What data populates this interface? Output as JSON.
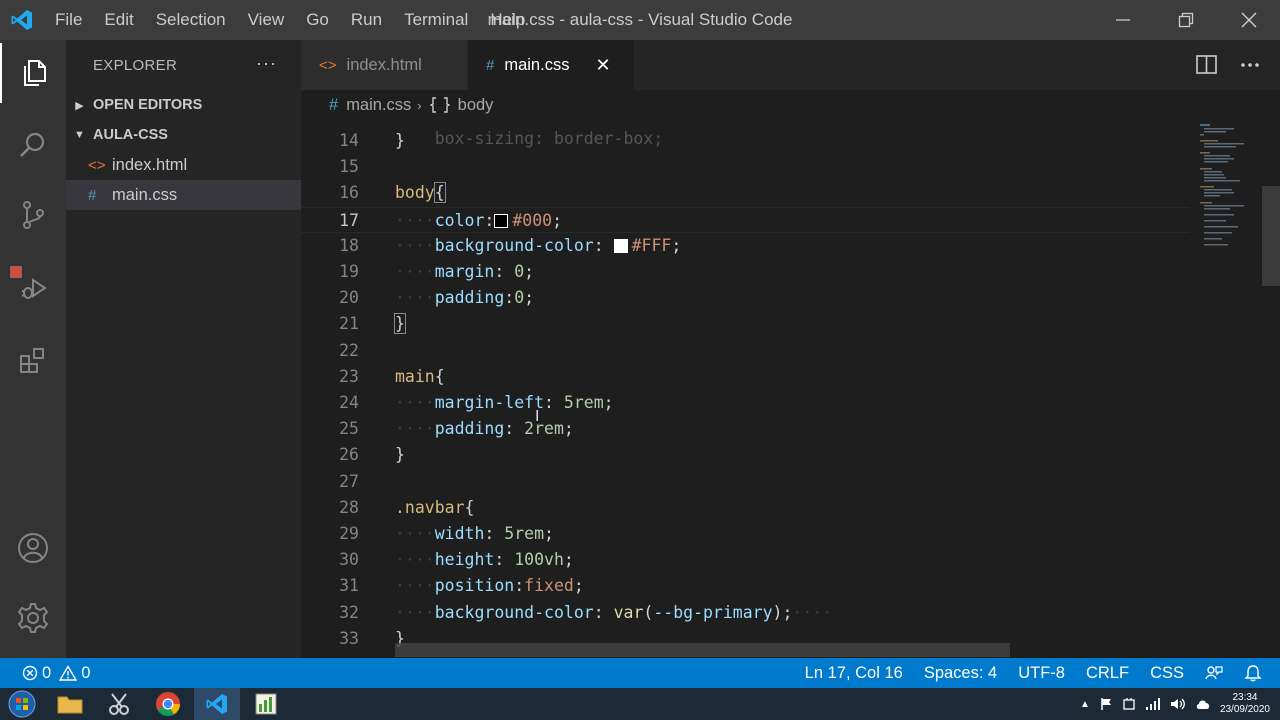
{
  "window": {
    "title": "main.css - aula-css - Visual Studio Code"
  },
  "menu": [
    "File",
    "Edit",
    "Selection",
    "View",
    "Go",
    "Run",
    "Terminal",
    "Help"
  ],
  "sidebar": {
    "header": "EXPLORER",
    "more": "···",
    "open_editors": "OPEN EDITORS",
    "folder": "AULA-CSS",
    "files": [
      {
        "name": "index.html",
        "icon": "<>",
        "icon_color": "#e37933"
      },
      {
        "name": "main.css",
        "icon": "#",
        "icon_color": "#519aba"
      }
    ]
  },
  "tabs": [
    {
      "label": "index.html",
      "icon": "<>",
      "icon_color": "#e37933"
    },
    {
      "label": "main.css",
      "icon": "#",
      "icon_color": "#519aba",
      "close": "✕"
    }
  ],
  "breadcrumbs": {
    "file_icon": "#",
    "file": "main.css",
    "separator": "›",
    "symbol": "body"
  },
  "editor": {
    "lines": [
      {
        "n": "14",
        "segments": [
          {
            "t": "}",
            "c": "punc"
          }
        ]
      },
      {
        "n": "15",
        "segments": []
      },
      {
        "n": "16",
        "segments": [
          {
            "t": "body",
            "c": "sel"
          },
          {
            "t": "{",
            "c": "punc bracket-hl"
          }
        ]
      },
      {
        "n": "17",
        "current": true,
        "segments": [
          {
            "t": "····",
            "c": "ws"
          },
          {
            "t": "color",
            "c": "prop"
          },
          {
            "t": ":",
            "c": "punc"
          },
          {
            "swatch": "#000000"
          },
          {
            "t": "#000",
            "c": "val"
          },
          {
            "t": ";",
            "c": "punc"
          }
        ]
      },
      {
        "n": "18",
        "segments": [
          {
            "t": "····",
            "c": "ws"
          },
          {
            "t": "background-color",
            "c": "prop"
          },
          {
            "t": ": ",
            "c": "punc"
          },
          {
            "swatch": "#ffffff"
          },
          {
            "t": "#FFF",
            "c": "val"
          },
          {
            "t": ";",
            "c": "punc"
          }
        ]
      },
      {
        "n": "19",
        "segments": [
          {
            "t": "····",
            "c": "ws"
          },
          {
            "t": "margin",
            "c": "prop"
          },
          {
            "t": ": ",
            "c": "punc"
          },
          {
            "t": "0",
            "c": "num"
          },
          {
            "t": ";",
            "c": "punc"
          }
        ]
      },
      {
        "n": "20",
        "segments": [
          {
            "t": "····",
            "c": "ws"
          },
          {
            "t": "padding",
            "c": "prop"
          },
          {
            "t": ":",
            "c": "punc"
          },
          {
            "t": "0",
            "c": "num"
          },
          {
            "t": ";",
            "c": "punc"
          }
        ]
      },
      {
        "n": "21",
        "segments": [
          {
            "t": "}",
            "c": "punc bracket-hl"
          }
        ]
      },
      {
        "n": "22",
        "segments": []
      },
      {
        "n": "23",
        "segments": [
          {
            "t": "main",
            "c": "sel"
          },
          {
            "t": "{",
            "c": "punc"
          }
        ]
      },
      {
        "n": "24",
        "segments": [
          {
            "t": "····",
            "c": "ws"
          },
          {
            "t": "margin-left",
            "c": "prop"
          },
          {
            "t": ": ",
            "c": "punc"
          },
          {
            "t": "5rem",
            "c": "num"
          },
          {
            "t": ";",
            "c": "punc"
          }
        ]
      },
      {
        "n": "25",
        "segments": [
          {
            "t": "····",
            "c": "ws"
          },
          {
            "t": "padding",
            "c": "prop"
          },
          {
            "t": ": ",
            "c": "punc"
          },
          {
            "t": "2rem",
            "c": "num"
          },
          {
            "t": ";",
            "c": "punc"
          }
        ]
      },
      {
        "n": "26",
        "segments": [
          {
            "t": "}",
            "c": "punc"
          }
        ]
      },
      {
        "n": "27",
        "segments": []
      },
      {
        "n": "28",
        "segments": [
          {
            "t": ".navbar",
            "c": "sel"
          },
          {
            "t": "{",
            "c": "punc"
          }
        ]
      },
      {
        "n": "29",
        "segments": [
          {
            "t": "····",
            "c": "ws"
          },
          {
            "t": "width",
            "c": "prop"
          },
          {
            "t": ": ",
            "c": "punc"
          },
          {
            "t": "5rem",
            "c": "num"
          },
          {
            "t": ";",
            "c": "punc"
          }
        ]
      },
      {
        "n": "30",
        "segments": [
          {
            "t": "····",
            "c": "ws"
          },
          {
            "t": "height",
            "c": "prop"
          },
          {
            "t": ": ",
            "c": "punc"
          },
          {
            "t": "100vh",
            "c": "num"
          },
          {
            "t": ";",
            "c": "punc"
          }
        ]
      },
      {
        "n": "31",
        "segments": [
          {
            "t": "····",
            "c": "ws"
          },
          {
            "t": "position",
            "c": "prop"
          },
          {
            "t": ":",
            "c": "punc"
          },
          {
            "t": "fixed",
            "c": "val"
          },
          {
            "t": ";",
            "c": "punc"
          }
        ]
      },
      {
        "n": "32",
        "segments": [
          {
            "t": "····",
            "c": "ws"
          },
          {
            "t": "background-color",
            "c": "prop"
          },
          {
            "t": ": ",
            "c": "punc"
          },
          {
            "t": "var",
            "c": "fn"
          },
          {
            "t": "(",
            "c": "punc"
          },
          {
            "t": "--bg-primary",
            "c": "prop"
          },
          {
            "t": ");",
            "c": "punc"
          },
          {
            "t": "····",
            "c": "ws"
          }
        ]
      },
      {
        "n": "33",
        "segments": [
          {
            "t": "}",
            "c": "punc"
          }
        ]
      }
    ]
  },
  "statusbar": {
    "errors": "0",
    "warnings": "0",
    "position": "Ln 17, Col 16",
    "spaces": "Spaces: 4",
    "encoding": "UTF-8",
    "eol": "CRLF",
    "language": "CSS"
  },
  "taskbar": {
    "time": "23:34",
    "date": "23/09/2020"
  },
  "colors": {
    "accent": "#007acc",
    "titlebar": "#3c3c3c",
    "activitybar": "#333333",
    "sidebar": "#252526",
    "editor": "#1e1e1e"
  }
}
